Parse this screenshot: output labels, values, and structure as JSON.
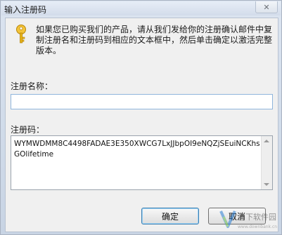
{
  "window": {
    "title": "输入注册码",
    "close_glyph": "✕"
  },
  "icons": {
    "title_icon": "none",
    "message_icon": "key-icon",
    "close": "close-icon"
  },
  "message": "如果您已购买我们的产品，请从我们发给你的注册确认邮件中复制注册名和注册码到相应的文本框中，然后单击确定以激活完整版本。",
  "fields": {
    "name_label": "注册名称：",
    "name_value": "",
    "code_label": "注册码：",
    "code_value": "WYMWDMM8C4498FADAE3E350XWCG7LxJJbpOI9eNQZjSEuiNCKhsGOlifetime"
  },
  "buttons": {
    "ok": "确定",
    "cancel": "取消"
  },
  "watermark": {
    "text": "当下软件园",
    "sub": "www.downbank.cn"
  },
  "colors": {
    "accent": "#3c7fb1",
    "key": "#e8b418"
  }
}
